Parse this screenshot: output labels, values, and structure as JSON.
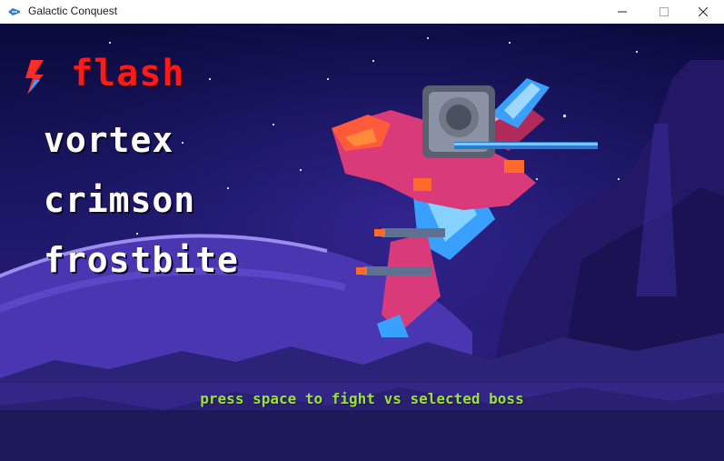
{
  "window": {
    "title": "Galactic Conquest",
    "icon": "spaceship-icon",
    "controls": {
      "minimize": "minimize-icon",
      "maximize": "maximize-icon",
      "close": "close-icon"
    }
  },
  "menu": {
    "selected_index": 0,
    "cursor_icon": "lightning-bolt-icon",
    "bosses": [
      {
        "label": "FLASH",
        "color": "#ff1a1a"
      },
      {
        "label": "VORTEX",
        "color": "#ffffff"
      },
      {
        "label": "CRIMSON",
        "color": "#ffffff"
      },
      {
        "label": "FROSTBITE",
        "color": "#ffffff"
      }
    ]
  },
  "prompt": {
    "text": "PRESS SPACE TO FIGHT VS SELECTED BOSS",
    "color": "#9be03a"
  },
  "scene": {
    "ship_icon": "boss-spaceship-icon",
    "colors": {
      "sky_top": "#0a0a3c",
      "sky_mid": "#2a1c7a",
      "planet": "#6a4fd0",
      "ship_body": "#d83a7a",
      "ship_accent": "#3aa0ff",
      "ship_orange": "#ff6a2a"
    }
  }
}
